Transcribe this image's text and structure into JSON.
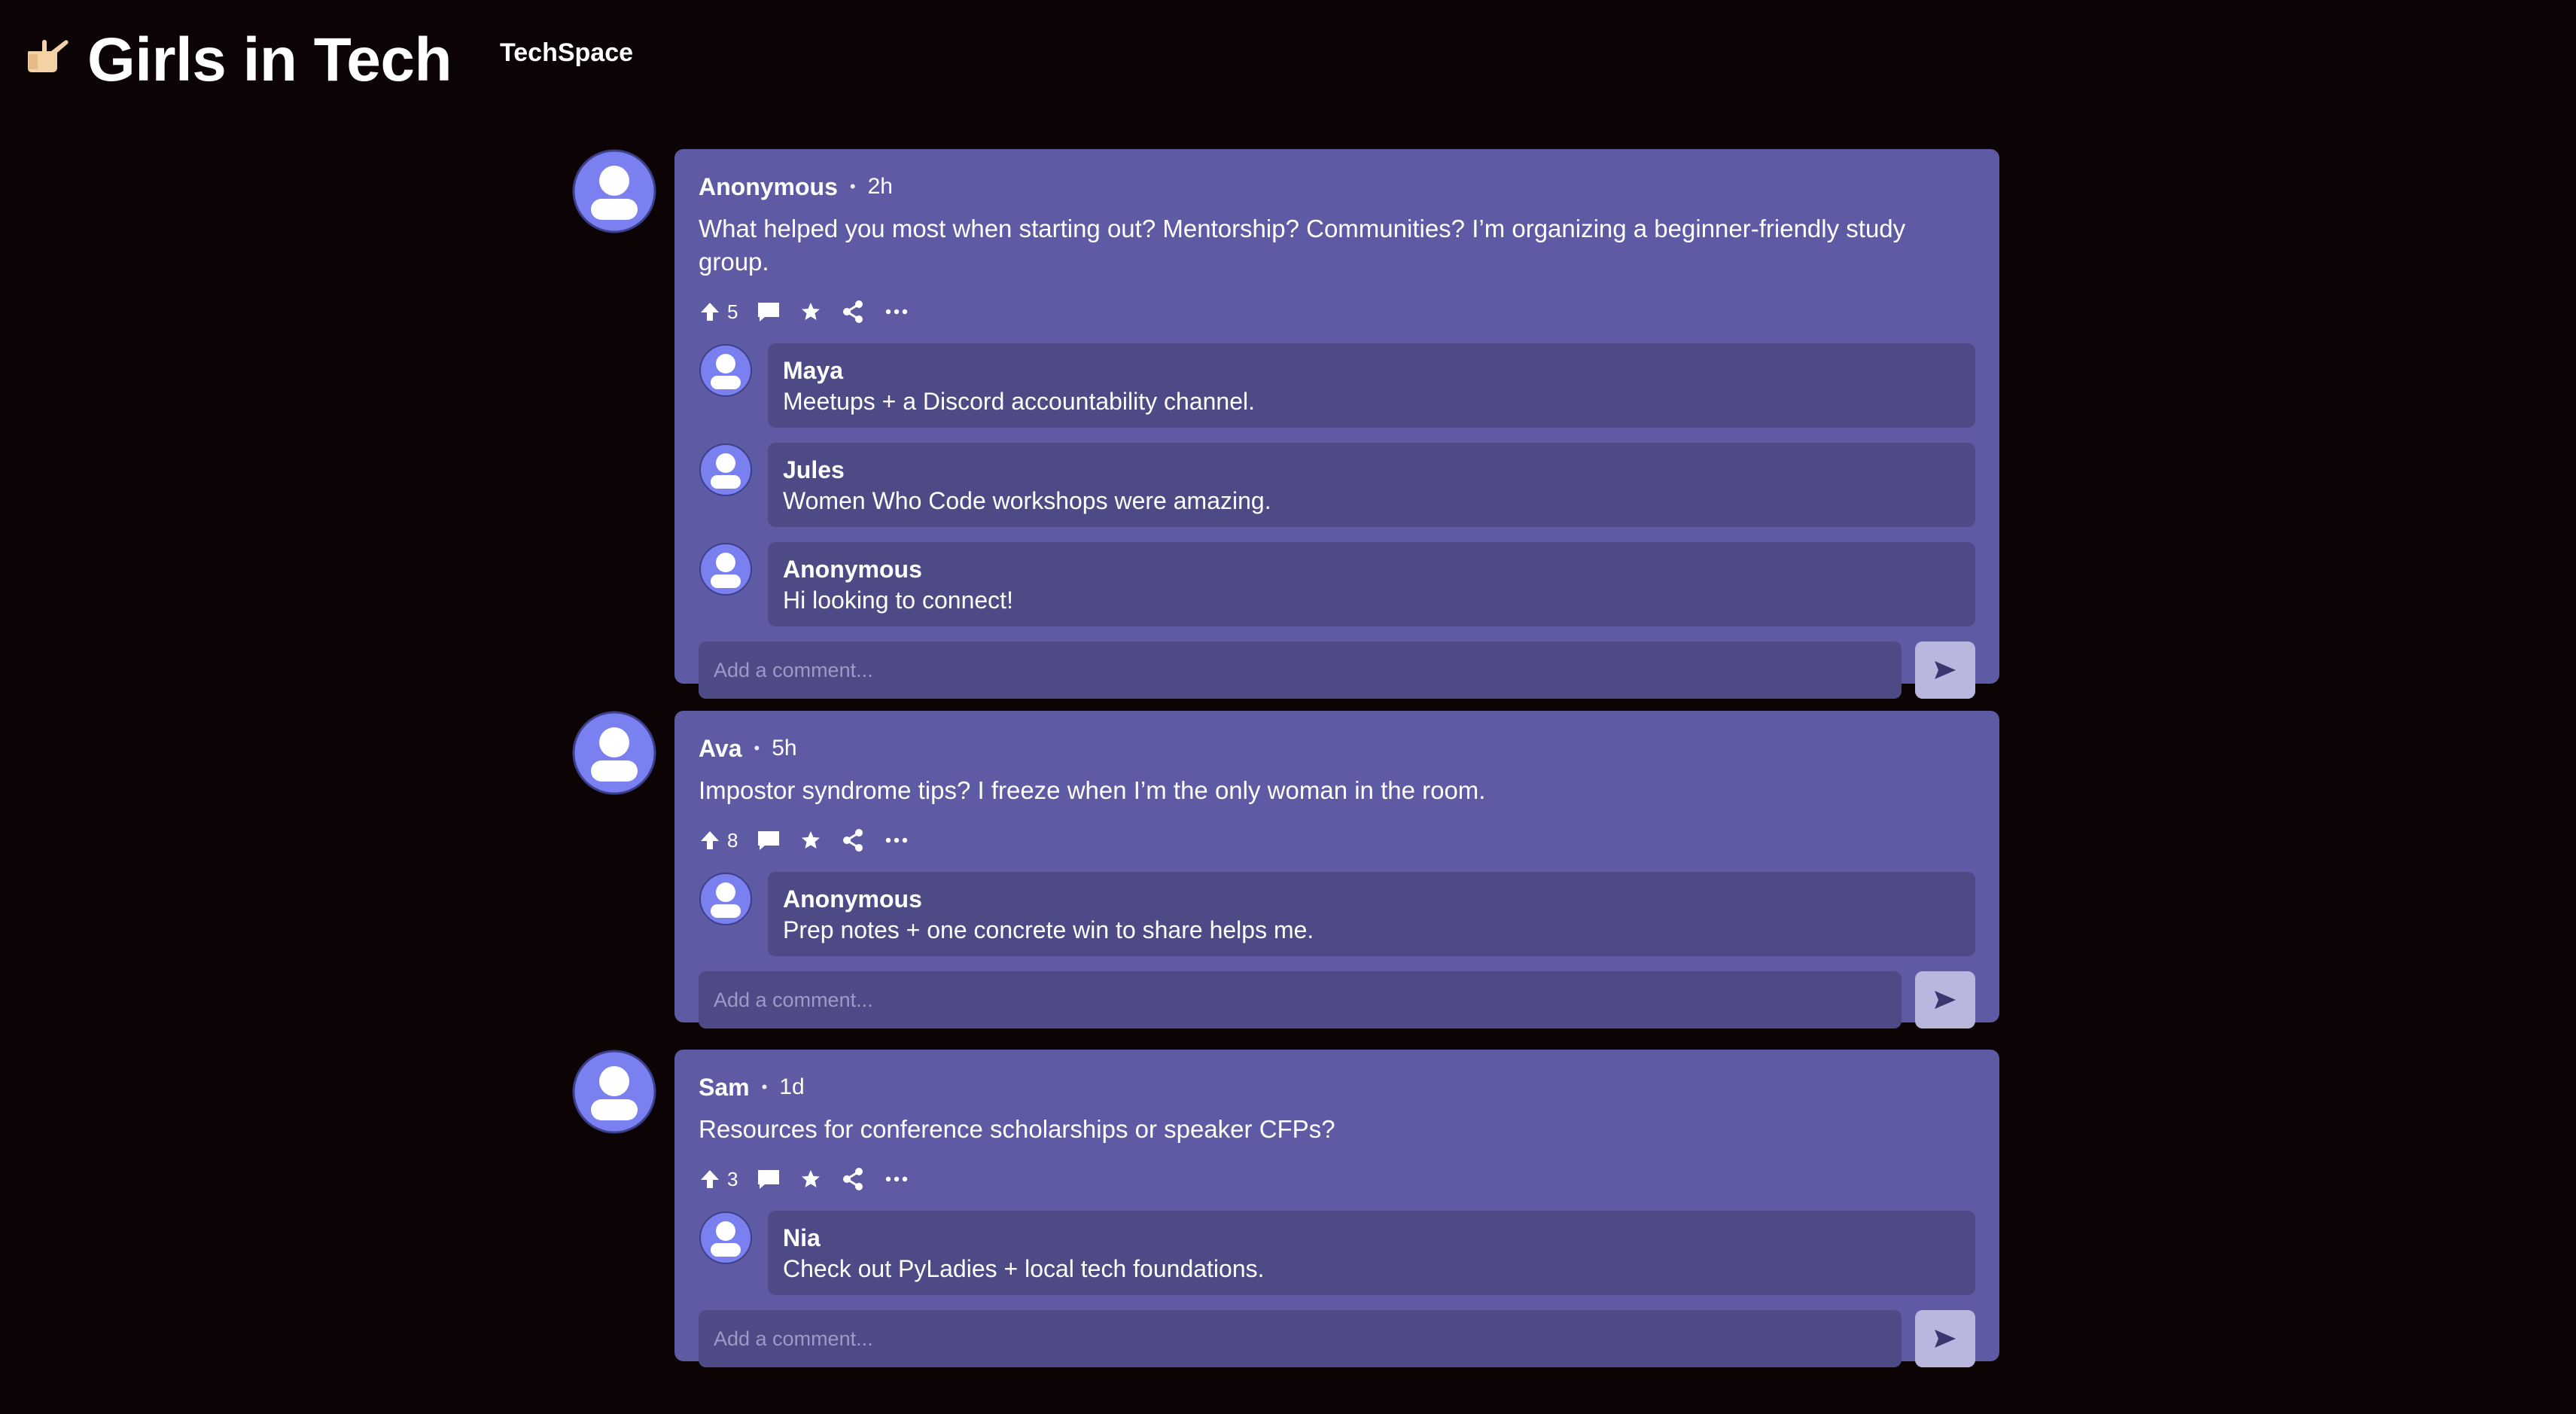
{
  "app": {
    "title": "Girls in Tech",
    "brand_link": "TechSpace",
    "logo_icon": "hand-pointing-icon"
  },
  "colors": {
    "background": "#0b0304",
    "card": "#5e5aa4",
    "reply_bubble": "#4d4a85",
    "send_button": "#b9b7de",
    "avatar": "#7b80f0"
  },
  "posts": [
    {
      "author": "Anonymous",
      "time": "2h",
      "text": "What helped you most when starting out? Mentorship? Communities? I’m organizing a beginner-friendly study group.",
      "upvotes": "5",
      "replies": [
        {
          "author": "Maya",
          "text": "Meetups + a Discord accountability channel."
        },
        {
          "author": "Jules",
          "text": "Women Who Code workshops were amazing."
        },
        {
          "author": "Anonymous",
          "text": "Hi looking to connect!"
        }
      ],
      "comment_placeholder": "Add a comment..."
    },
    {
      "author": "Ava",
      "time": "5h",
      "text": "Impostor syndrome tips? I freeze when I’m the only woman in the room.",
      "upvotes": "8",
      "replies": [
        {
          "author": "Anonymous",
          "text": "Prep notes + one concrete win to share helps me."
        }
      ],
      "comment_placeholder": "Add a comment..."
    },
    {
      "author": "Sam",
      "time": "1d",
      "text": "Resources for conference scholarships or speaker CFPs?",
      "upvotes": "3",
      "replies": [
        {
          "author": "Nia",
          "text": "Check out PyLadies + local tech foundations."
        }
      ],
      "comment_placeholder": "Add a comment..."
    }
  ],
  "icons": {
    "upvote": "arrow-up-icon",
    "comment": "comment-icon",
    "favorite": "star-icon",
    "share": "share-icon",
    "more": "more-icon",
    "send": "send-icon"
  }
}
